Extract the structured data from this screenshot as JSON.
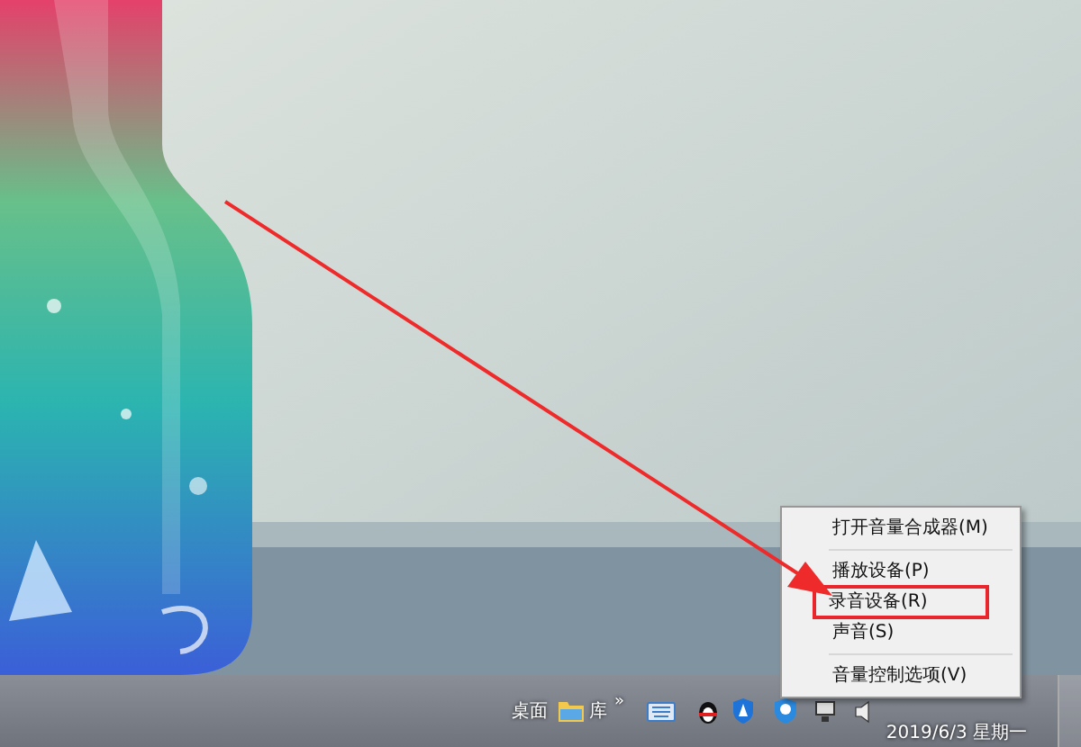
{
  "annotation": {
    "kind": "arrow"
  },
  "context_menu": {
    "items": [
      {
        "kind": "item",
        "label": "打开音量合成器(M)",
        "marked": false
      },
      {
        "kind": "separator"
      },
      {
        "kind": "item",
        "label": "播放设备(P)",
        "marked": false
      },
      {
        "kind": "item",
        "label": "录音设备(R)",
        "marked": true
      },
      {
        "kind": "item",
        "label": "声音(S)",
        "marked": false
      },
      {
        "kind": "separator"
      },
      {
        "kind": "item",
        "label": "音量控制选项(V)",
        "marked": false
      }
    ]
  },
  "taskbar": {
    "desktop_label": "桌面",
    "toolbar_label": "库",
    "chevron": "»",
    "date": "2019/6/3 星期一"
  }
}
